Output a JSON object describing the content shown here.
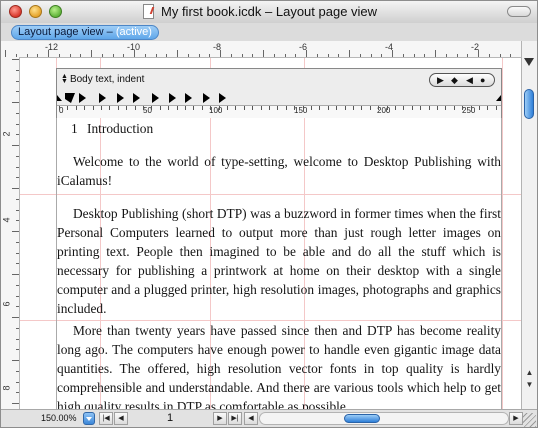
{
  "window": {
    "title": "My first book.icdk – Layout page view"
  },
  "view_tab": {
    "label": "Layout page view – ",
    "state": "(active)"
  },
  "rulers": {
    "horizontal_labels": [
      "-12",
      "-10",
      "-8",
      "-6",
      "-4",
      "-2"
    ],
    "vertical_labels": [
      "2",
      "4",
      "6",
      "8"
    ]
  },
  "frame_ruler": {
    "paragraph_style": "Body text, indent",
    "scale_labels": [
      "0",
      "50",
      "100",
      "150",
      "200",
      "250"
    ],
    "tab_controls": [
      "▶",
      "◆",
      "◀",
      "●"
    ]
  },
  "document": {
    "heading_number": "1",
    "heading_text": "Introduction",
    "paragraphs": [
      "Welcome to the world of type-setting, welcome to Desktop Publishing with iCalamus!",
      "Desktop Publishing (short DTP) was a buzzword in former times when the first Personal Computers learned to output more than just rough letter images on printing text. People then imagined to be able and do all the stuff which is necessary for publishing a printwork at home on their desktop with a single computer and a plugged printer, high resolution images, photographs and graphics included.",
      "More than twenty years have passed since then and DTP has become reality long ago. The computers have enough power to handle even gigantic image data quantities. The offered, high resolution vector fonts in top quality is hardly comprehensible and understandable. And there are various tools which help to get high quality results in DTP as comfortable as possible."
    ]
  },
  "status_bar": {
    "zoom": "150.00%",
    "page_number": "1",
    "nav": {
      "first": "|◀",
      "prev": "◀",
      "next": "▶",
      "last": "▶|"
    }
  },
  "colors": {
    "accent": "#5fa6ea",
    "guide": "#f4c8c8"
  }
}
